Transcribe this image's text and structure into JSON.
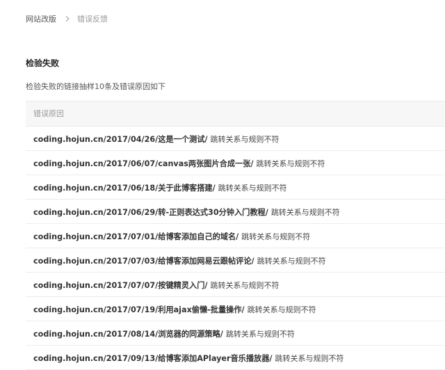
{
  "breadcrumb": {
    "parent": "网站改版",
    "current": "错误反馈"
  },
  "section": {
    "title": "检验失败",
    "description": "检验失败的链接抽样10条及错误原因如下"
  },
  "table": {
    "header": "错误原因",
    "rows": [
      {
        "url": "coding.hojun.cn/2017/04/26/这是一个测试/",
        "reason": "跳转关系与规则不符"
      },
      {
        "url": "coding.hojun.cn/2017/06/07/canvas两张图片合成一张/",
        "reason": "跳转关系与规则不符"
      },
      {
        "url": "coding.hojun.cn/2017/06/18/关于此博客搭建/",
        "reason": "跳转关系与规则不符"
      },
      {
        "url": "coding.hojun.cn/2017/06/29/转-正则表达式30分钟入门教程/",
        "reason": "跳转关系与规则不符"
      },
      {
        "url": "coding.hojun.cn/2017/07/01/给博客添加自己的域名/",
        "reason": "跳转关系与规则不符"
      },
      {
        "url": "coding.hojun.cn/2017/07/03/给博客添加网易云跟帖评论/",
        "reason": "跳转关系与规则不符"
      },
      {
        "url": "coding.hojun.cn/2017/07/07/按键精灵入门/",
        "reason": "跳转关系与规则不符"
      },
      {
        "url": "coding.hojun.cn/2017/07/19/利用ajax偷懒-批量操作/",
        "reason": "跳转关系与规则不符"
      },
      {
        "url": "coding.hojun.cn/2017/08/14/浏览器的同源策略/",
        "reason": "跳转关系与规则不符"
      },
      {
        "url": "coding.hojun.cn/2017/09/13/给博客添加APlayer音乐播放器/",
        "reason": "跳转关系与规则不符"
      }
    ]
  }
}
